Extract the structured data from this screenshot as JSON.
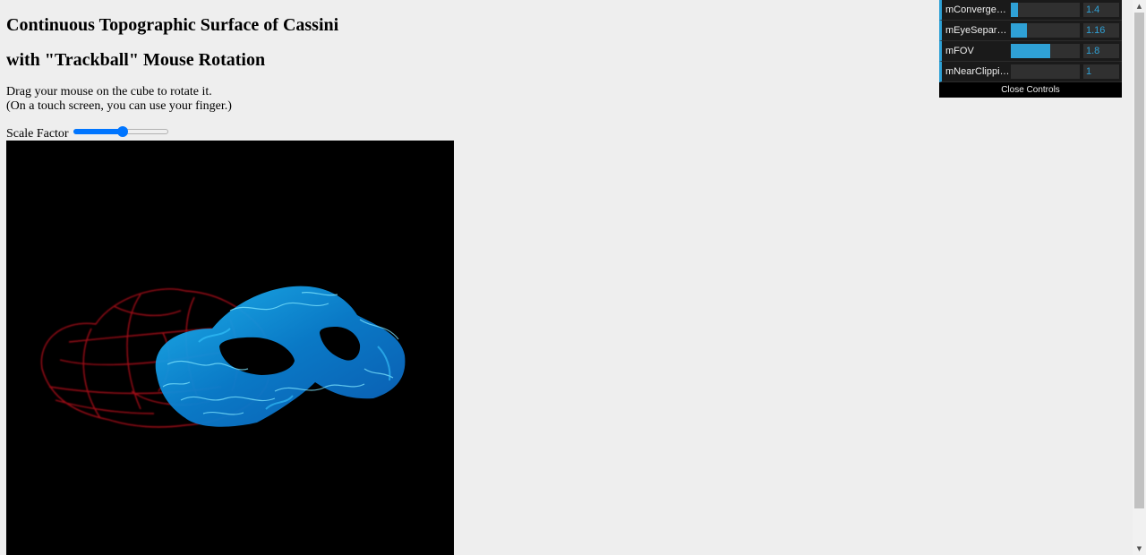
{
  "page": {
    "title_line1": "Continuous Topographic Surface of Cassini",
    "title_line2": "with \"Trackball\" Mouse Rotation",
    "instruction_line1": "Drag your mouse on the cube to rotate it.",
    "instruction_line2": "(On a touch screen, you can use your finger.)"
  },
  "scale_slider": {
    "label": "Scale Factor",
    "fraction": 0.52,
    "accent_color": "#0075ff"
  },
  "viewport": {
    "background": "#000000",
    "left_eye_color": "#c0101a",
    "right_eye_color": "#1aa6e8"
  },
  "gui": {
    "accent_color": "#2fa1d6",
    "controls": [
      {
        "name": "mConvergence",
        "value": "1.4",
        "fraction": 0.1
      },
      {
        "name": "mEyeSeparation",
        "value": "1.16",
        "fraction": 0.23
      },
      {
        "name": "mFOV",
        "value": "1.8",
        "fraction": 0.57
      },
      {
        "name": "mNearClippingDistance",
        "value": "1",
        "fraction": 0.0
      }
    ],
    "close_label": "Close Controls"
  },
  "scrollbar": {
    "up_icon": "scroll-up-arrow-icon",
    "down_icon": "scroll-down-arrow-icon"
  }
}
